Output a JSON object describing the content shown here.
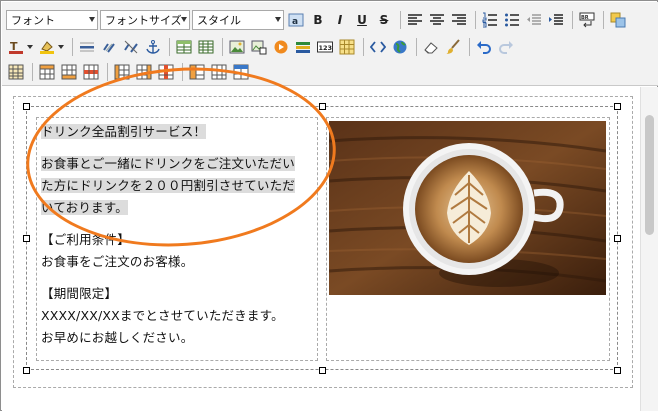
{
  "toolbar": {
    "font_select": "フォント",
    "size_select": "フォントサイズ",
    "style_select": "スタイル",
    "bold": "B",
    "italic": "I",
    "underline": "U",
    "strike": "S"
  },
  "content": {
    "lines": [
      "ドリンク全品割引サービス！",
      "お食事とご一緒にドリンクをご注文いただい",
      "た方にドリンクを２００円割引させていただ",
      "いております。",
      "【ご利用条件】",
      "お食事をご注文のお客様。",
      "【期間限定】",
      "XXXX/XX/XXまでとさせていただきます。",
      "お早めにお越しください。"
    ]
  },
  "image": {
    "alt_icon": "latte-art-coffee-photo"
  },
  "colors": {
    "annotation": "#f07a1e",
    "highlight": "#dcdcdc"
  }
}
